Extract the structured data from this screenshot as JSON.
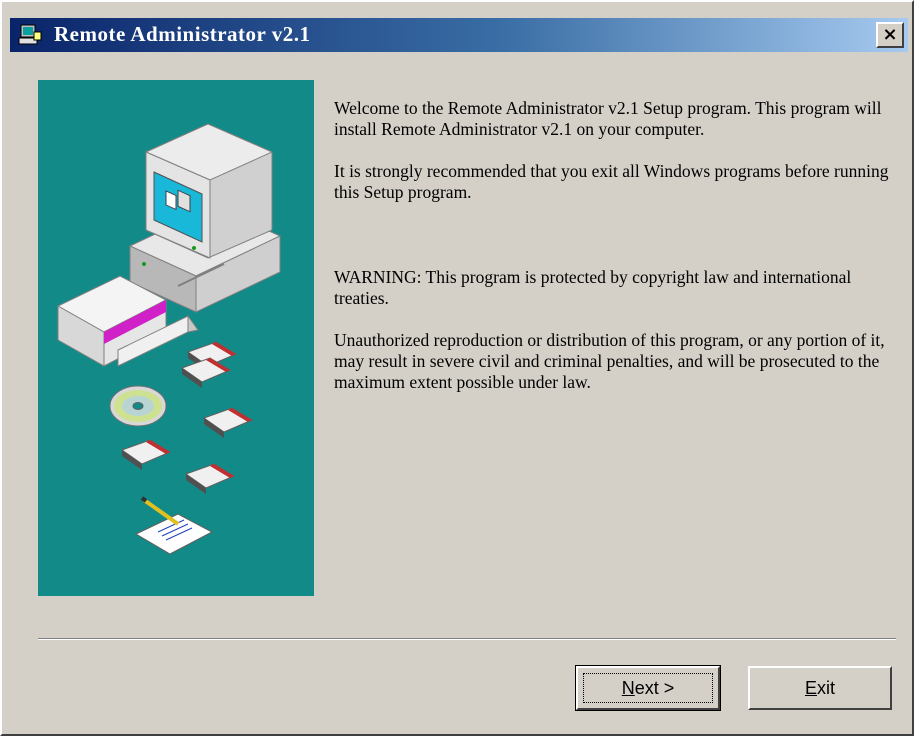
{
  "window": {
    "title": "Remote Administrator v2.1",
    "close_glyph": "×"
  },
  "content": {
    "welcome": "Welcome to the Remote Administrator v2.1 Setup program. This program will install Remote Administrator v2.1 on your computer.",
    "recommend": "It is strongly recommended that you exit all Windows programs before running this Setup program.",
    "warning": "WARNING: This program is protected by copyright law and international treaties.",
    "unauthorized": "Unauthorized reproduction or distribution of this program, or any portion of it, may result in severe civil and criminal penalties, and will be prosecuted to the maximum extent possible under law."
  },
  "buttons": {
    "next": {
      "mnemonic": "N",
      "rest": "ext >"
    },
    "exit": {
      "mnemonic": "E",
      "rest": "xit"
    }
  },
  "colors": {
    "title_start": "#0a246a",
    "title_end": "#a6caf0",
    "illustration_bg": "#128a88",
    "window_bg": "#d4d0c8"
  },
  "icons": [
    "setup-app-icon",
    "close-icon",
    "computer-icon",
    "software-box-icon",
    "cd-disc-icon",
    "floppy-disk-icon",
    "notepad-pencil-icon"
  ]
}
